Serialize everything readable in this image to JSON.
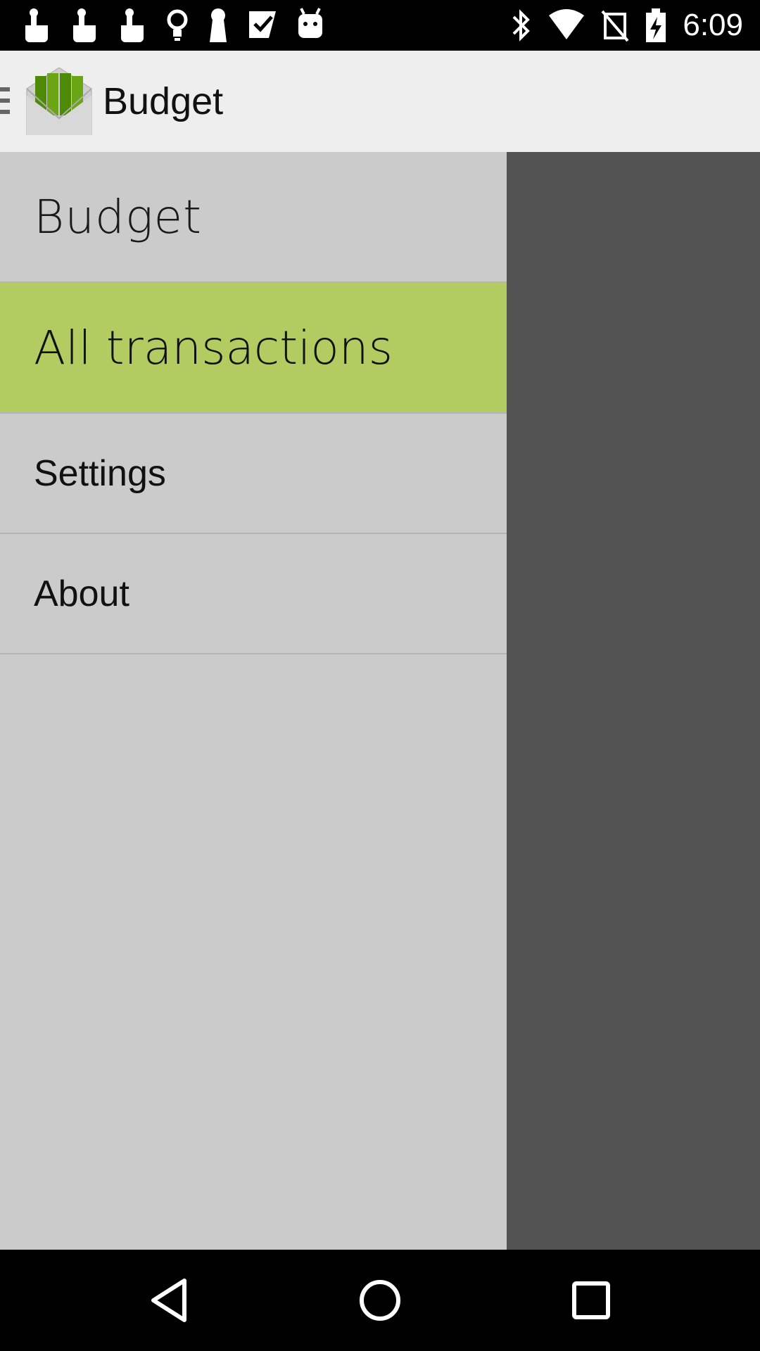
{
  "status_bar": {
    "time": "6:09",
    "left_icons": [
      "touch-icon",
      "touch-icon",
      "touch-icon",
      "lightbulb-icon",
      "keyhole-icon",
      "check-icon",
      "android-icon"
    ],
    "right_icons": [
      "bluetooth-icon",
      "wifi-icon",
      "no-sim-icon",
      "battery-charging-icon"
    ]
  },
  "action_bar": {
    "title": "Budget",
    "logo_icon": "budget-envelope-icon",
    "nav_icon": "drawer-indicator-icon"
  },
  "drawer": {
    "header": "Budget",
    "items": [
      {
        "label": "All transactions",
        "active": true
      },
      {
        "label": "Settings",
        "active": false
      },
      {
        "label": "About",
        "active": false
      }
    ]
  },
  "nav_bar": {
    "buttons": [
      "back-icon",
      "home-icon",
      "recents-icon"
    ]
  },
  "colors": {
    "active_item": "#b2cc62",
    "drawer_bg": "#cbcbcb",
    "scrim": "#535353",
    "action_bar": "#eeeeee",
    "logo_green": "#5a9a0a"
  }
}
